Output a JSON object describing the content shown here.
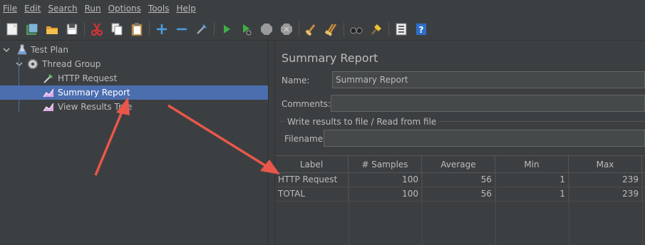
{
  "menu": [
    "File",
    "Edit",
    "Search",
    "Run",
    "Options",
    "Tools",
    "Help"
  ],
  "toolbar": {
    "icons": [
      "new-icon",
      "templates-icon",
      "open-icon",
      "save-icon",
      "cut-icon",
      "copy-icon",
      "paste-icon",
      "expand-icon",
      "collapse-icon",
      "toggle-icon",
      "start-icon",
      "start-no-pause-icon",
      "stop-icon",
      "shutdown-icon",
      "clear-icon",
      "clear-all-icon",
      "search-icon",
      "reset-search-icon",
      "function-helper-icon",
      "help-icon"
    ]
  },
  "tree": {
    "items": [
      {
        "label": "Test Plan",
        "icon": "test-plan-icon"
      },
      {
        "label": "Thread Group",
        "icon": "gear-icon"
      },
      {
        "label": "HTTP Request",
        "icon": "sampler-icon"
      },
      {
        "label": "Summary Report",
        "icon": "report-icon",
        "selected": true
      },
      {
        "label": "View Results Tree",
        "icon": "report-icon"
      }
    ]
  },
  "panel": {
    "title": "Summary Report",
    "name_label": "Name:",
    "name_value": "Summary Report",
    "comments_label": "Comments:",
    "comments_value": "",
    "group_title": "Write results to file / Read from file",
    "filename_label": "Filename",
    "filename_value": ""
  },
  "table": {
    "columns": [
      "Label",
      "# Samples",
      "Average",
      "Min",
      "Max"
    ],
    "rows": [
      [
        "HTTP Request",
        "100",
        "56",
        "1",
        "239"
      ],
      [
        "TOTAL",
        "100",
        "56",
        "1",
        "239"
      ]
    ]
  },
  "colors": {
    "background": "#3c3f41",
    "selection": "#4b6eaf",
    "annotation_arrow": "#e8574a"
  }
}
